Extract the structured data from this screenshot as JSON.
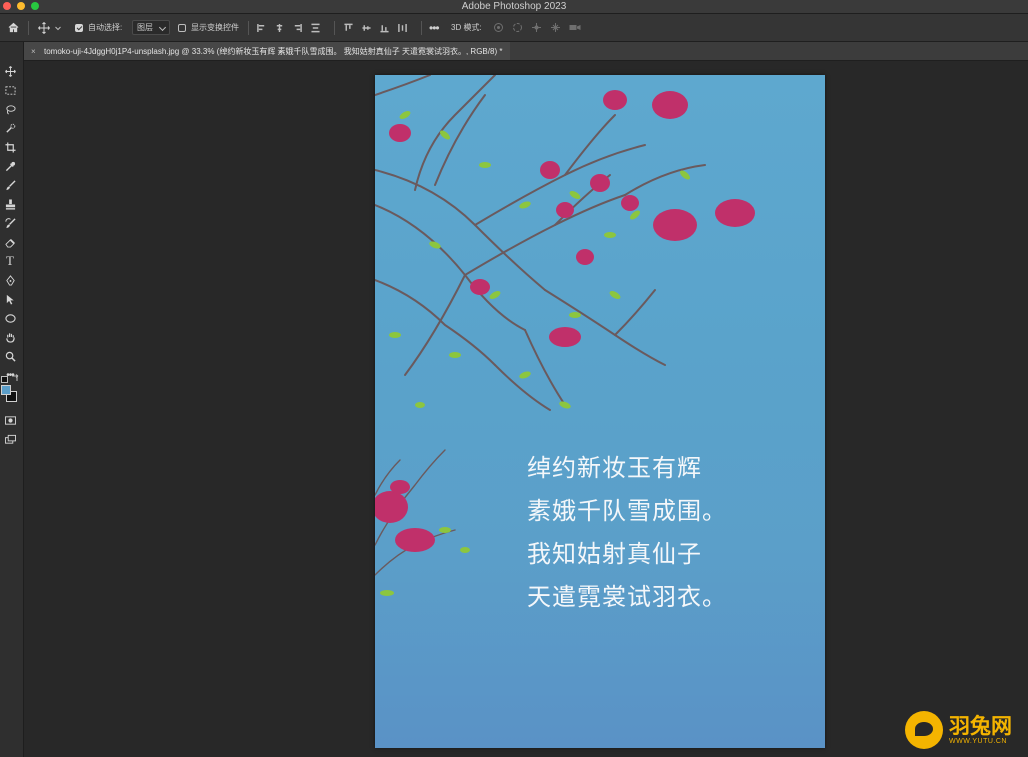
{
  "window": {
    "app_title": "Adobe Photoshop 2023"
  },
  "options_bar": {
    "auto_select_label": "自动选择:",
    "auto_select_checked": true,
    "auto_select_value": "图层",
    "show_transform_label": "显示变换控件",
    "show_transform_checked": false,
    "mode_3d_label": "3D 模式:"
  },
  "document_tab": {
    "title": "tomoko-uji-4JdggH0j1P4-unsplash.jpg @ 33.3% (绰约新妆玉有辉 素娥千队雪成围。 我知姑射真仙子 天遣霓裳试羽衣。, RGB/8) *"
  },
  "tools": [
    "move-icon",
    "marquee-icon",
    "lasso-icon",
    "quick-select-icon",
    "crop-icon",
    "eyedropper-icon",
    "brush-icon",
    "stamp-icon",
    "history-brush-icon",
    "eraser-icon",
    "text-icon",
    "pen-icon",
    "path-select-icon",
    "ellipse-icon",
    "hand-icon",
    "zoom-icon",
    "more-tools-icon"
  ],
  "colors": {
    "foreground": "#5b9ec9",
    "background": "#111111",
    "canvas_top": "#5ea8cf",
    "accent": "#f4b400"
  },
  "poem": {
    "line1": "绰约新妆玉有辉",
    "line2": "素娥千队雪成围。",
    "line3": "我知姑射真仙子",
    "line4": "天遣霓裳试羽衣。"
  },
  "watermark": {
    "brand": "羽兔网",
    "url": "WWW.YUTU.CN"
  }
}
